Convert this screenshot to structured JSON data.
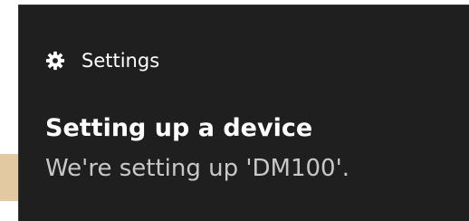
{
  "toast": {
    "app_name": "Settings",
    "app_icon": "gear-icon",
    "title": "Setting up a device",
    "body": "We're setting up 'DM100'."
  },
  "colors": {
    "toast_background": "#1f1f1f",
    "title_text": "#ffffff",
    "body_text": "#c8c8c8",
    "background_strip": "#e2c9a2"
  }
}
